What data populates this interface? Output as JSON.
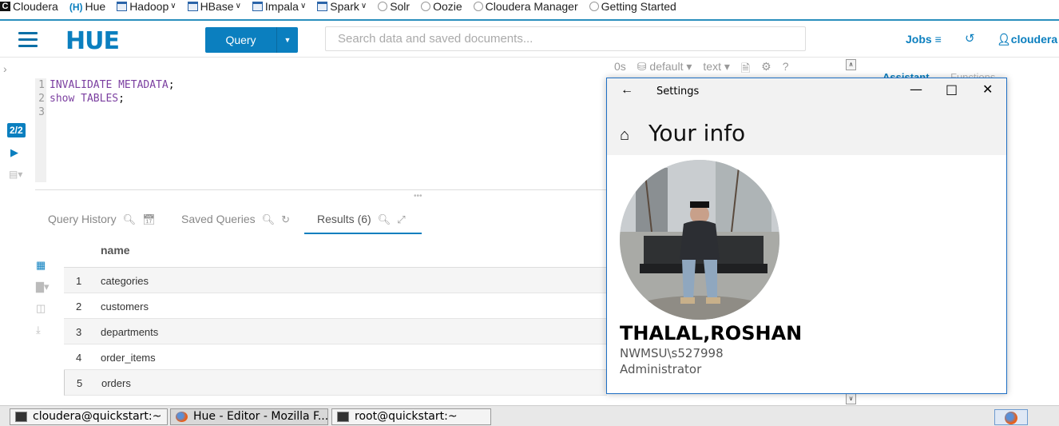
{
  "bookmarks": [
    {
      "label": "Cloudera",
      "icon": "cloudera-icon",
      "dropdown": false
    },
    {
      "label": "Hue",
      "icon": "hue-icon",
      "dropdown": false
    },
    {
      "label": "Hadoop",
      "icon": "folder-icon",
      "dropdown": true
    },
    {
      "label": "HBase",
      "icon": "folder-icon",
      "dropdown": true
    },
    {
      "label": "Impala",
      "icon": "folder-icon",
      "dropdown": true
    },
    {
      "label": "Spark",
      "icon": "folder-icon",
      "dropdown": true
    },
    {
      "label": "Solr",
      "icon": "globe-icon",
      "dropdown": false
    },
    {
      "label": "Oozie",
      "icon": "globe-icon",
      "dropdown": false
    },
    {
      "label": "Cloudera Manager",
      "icon": "globe-icon",
      "dropdown": false
    },
    {
      "label": "Getting Started",
      "icon": "globe-icon",
      "dropdown": false
    }
  ],
  "nav": {
    "logo": "HUE",
    "query_label": "Query",
    "search_placeholder": "Search data and saved documents...",
    "jobs_label": "Jobs",
    "user_label": "cloudera"
  },
  "editor": {
    "statement_badge": "2/2",
    "line_numbers": [
      "1",
      "2",
      "3"
    ],
    "lines": [
      {
        "kw": "INVALIDATE METADATA",
        "rest": ";"
      },
      {
        "kw": "show TABLES",
        "rest": ";"
      },
      {
        "kw": "",
        "rest": ""
      }
    ],
    "time": "0s",
    "database": "default",
    "format": "text"
  },
  "tabs": {
    "history": "Query History",
    "saved": "Saved Queries",
    "results": "Results (6)"
  },
  "results": {
    "column": "name",
    "rows": [
      {
        "n": "1",
        "v": "categories"
      },
      {
        "n": "2",
        "v": "customers"
      },
      {
        "n": "3",
        "v": "departments"
      },
      {
        "n": "4",
        "v": "order_items"
      },
      {
        "n": "5",
        "v": "orders"
      }
    ]
  },
  "assistant": {
    "tab1": "Assistant",
    "tab2": "Functions"
  },
  "settings": {
    "window_title": "Settings",
    "page_title": "Your info",
    "display_name": "THALAL,ROSHAN",
    "account": "NWMSU\\s527998",
    "role": "Administrator"
  },
  "taskbar": [
    {
      "label": "cloudera@quickstart:~",
      "icon": "terminal-icon"
    },
    {
      "label": "Hue - Editor - Mozilla F...",
      "icon": "firefox-icon"
    },
    {
      "label": "root@quickstart:~",
      "icon": "terminal-icon"
    }
  ],
  "colors": {
    "accent": "#0b7fbf",
    "window_border": "#1e6fc4"
  }
}
